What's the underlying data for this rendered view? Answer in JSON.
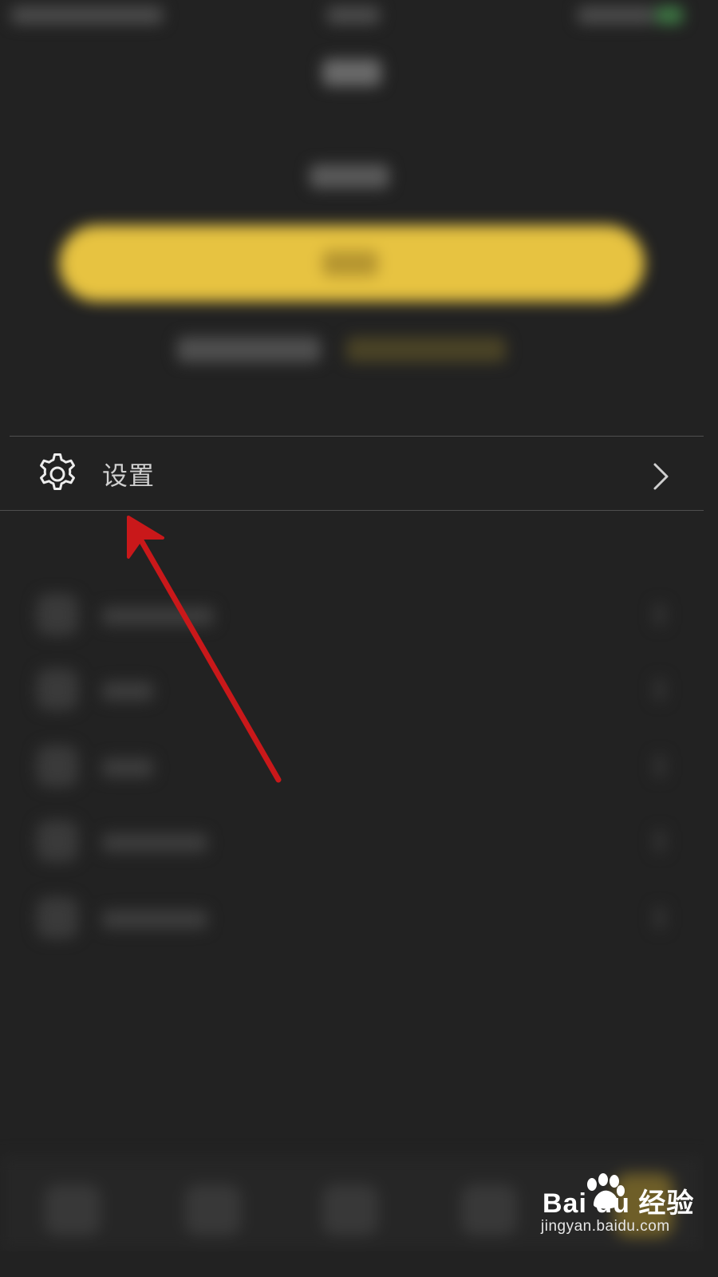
{
  "settings_row": {
    "label": "设置",
    "icon": "gear-icon",
    "chevron": "chevron-right-icon"
  },
  "annotation": {
    "type": "arrow",
    "color": "#c9181a",
    "target": "settings_row"
  },
  "watermark": {
    "logo_text": "Bai du 经验",
    "url": "jingyan.baidu.com"
  },
  "colors": {
    "background": "#222222",
    "login_button": "#e7c341",
    "text_primary": "#cfcfcf",
    "divider": "#4f4f4f"
  }
}
